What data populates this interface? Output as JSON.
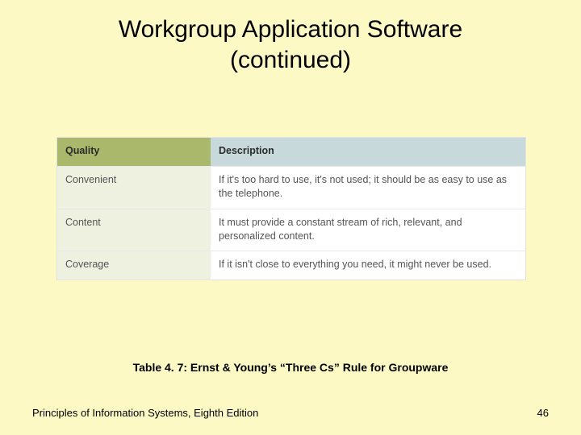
{
  "title": {
    "line1": "Workgroup Application Software",
    "line2": "(continued)"
  },
  "table": {
    "headers": {
      "quality": "Quality",
      "description": "Description"
    },
    "rows": [
      {
        "quality": "Convenient",
        "description": "If it's too hard to use, it's not used; it should be as easy to use as the telephone."
      },
      {
        "quality": "Content",
        "description": "It must provide a constant stream of rich, relevant, and personalized content."
      },
      {
        "quality": "Coverage",
        "description": "If it isn't close to everything you need, it might never be used."
      }
    ]
  },
  "caption": "Table 4. 7: Ernst & Young’s “Three Cs” Rule for Groupware",
  "footer": {
    "left": "Principles of Information Systems, Eighth Edition",
    "pageNumber": "46"
  }
}
